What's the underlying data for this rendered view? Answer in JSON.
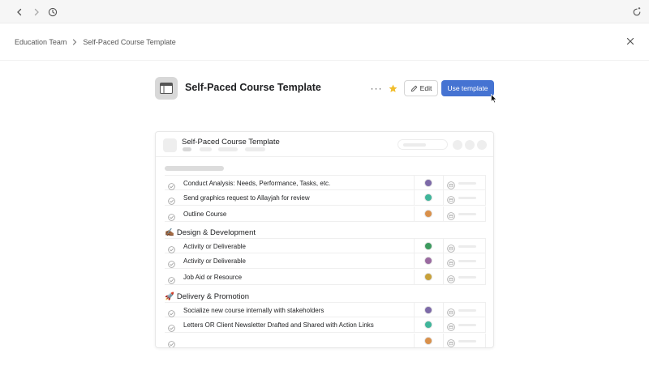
{
  "breadcrumb": {
    "parent": "Education Team",
    "current": "Self-Paced Course Template"
  },
  "header": {
    "title": "Self-Paced Course Template",
    "more_label": "···",
    "edit_label": "Edit",
    "use_label": "Use template"
  },
  "preview": {
    "title": "Self-Paced Course Template",
    "sections": [
      {
        "title": "",
        "emoji": "",
        "tasks": [
          {
            "name": "Conduct Analysis: Needs, Performance, Tasks, etc.",
            "avatar_color": "#7d6aa8"
          },
          {
            "name": "Send graphics request to Allayjah for review",
            "avatar_color": "#3fb59a"
          },
          {
            "name": "Outline Course",
            "avatar_color": "#d9904a"
          }
        ]
      },
      {
        "title": "Design & Development",
        "emoji": "✍🏾",
        "tasks": [
          {
            "name": "Activity or Deliverable",
            "avatar_color": "#3c9a5e"
          },
          {
            "name": "Activity or Deliverable",
            "avatar_color": "#9a6aa0"
          },
          {
            "name": "Job Aid or Resource",
            "avatar_color": "#c8a13a"
          }
        ]
      },
      {
        "title": "Delivery & Promotion",
        "emoji": "🚀",
        "tasks": [
          {
            "name": "Socialize new course internally with stakeholders",
            "avatar_color": "#7d6aa8"
          },
          {
            "name": "Letters OR Client Newsletter Drafted and Shared with Action Links",
            "avatar_color": "#3fb59a"
          },
          {
            "name": "",
            "avatar_color": "#d9904a"
          }
        ]
      }
    ]
  },
  "colors": {
    "accent": "#4573d2",
    "star": "#f1bd2b",
    "topbar_bg": "#f6f6f6"
  },
  "icons": {
    "back": "chevron-left-icon",
    "forward": "chevron-right-icon",
    "history": "clock-icon",
    "sync": "sync-icon",
    "close": "close-icon",
    "template": "template-icon",
    "more": "more-icon",
    "star": "star-icon",
    "edit": "pencil-icon",
    "check": "check-circle-icon",
    "calendar": "calendar-icon"
  }
}
